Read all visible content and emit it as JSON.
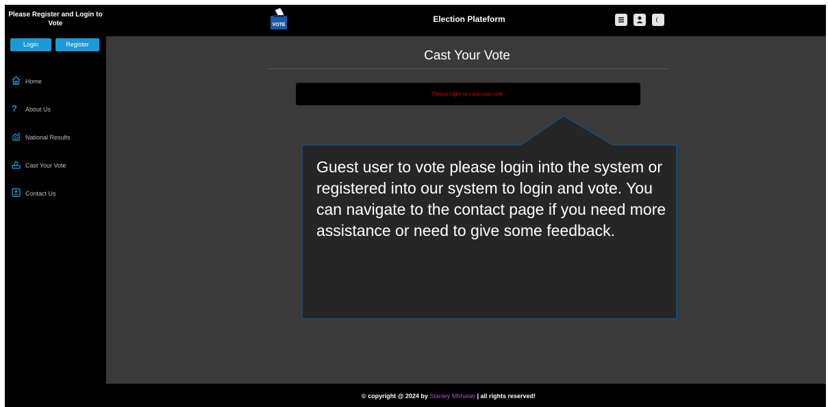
{
  "sidebar": {
    "title": "Please Register and Login to Vote",
    "login_label": "Login",
    "register_label": "Register",
    "items": [
      {
        "label": "Home",
        "icon": "home-icon"
      },
      {
        "label": "About Us",
        "icon": "question-icon"
      },
      {
        "label": "National Results",
        "icon": "chart-icon"
      },
      {
        "label": "Cast Your Vote",
        "icon": "ballot-icon"
      },
      {
        "label": "Contact Us",
        "icon": "contact-card-icon"
      }
    ]
  },
  "header": {
    "title": "Election Plateform",
    "logo_text": "VOTE"
  },
  "main": {
    "heading": "Cast Your Vote",
    "message": "Please login to cast your vote.",
    "callout_text": "Guest user to vote please login into the system or registered into our system to login and vote. You can navigate to the contact page if you need more assistance or need to give some feedback."
  },
  "footer": {
    "prefix": "© copyright @ 2024 by",
    "author": "Stanley Mbhalati",
    "suffix": "| all rights reserved!"
  },
  "colors": {
    "accent": "#1a9ad6",
    "error": "#d10000",
    "author_link": "#9b59b6",
    "callout_border": "#1e4a66"
  }
}
